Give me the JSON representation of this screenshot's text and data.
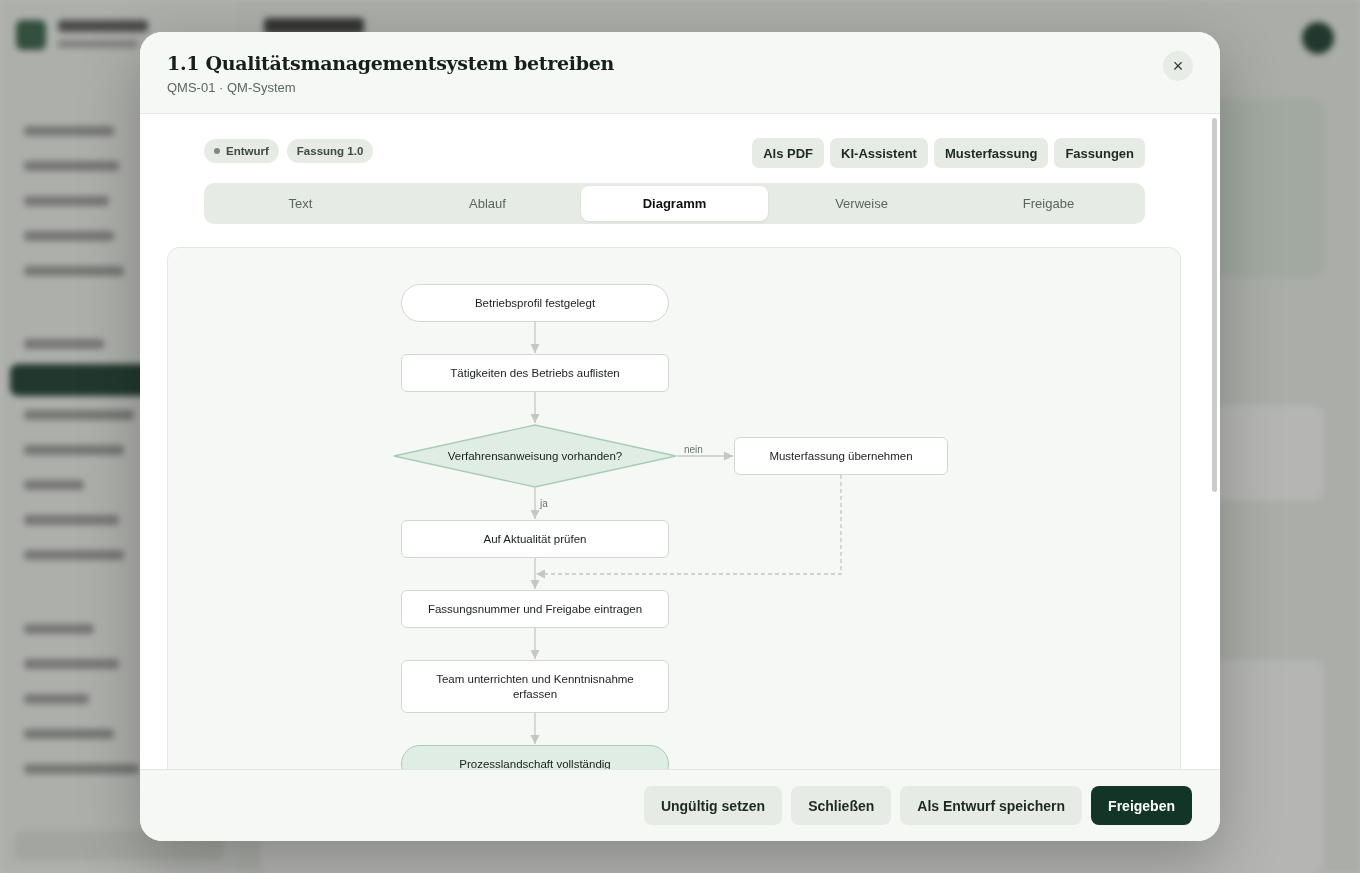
{
  "dialog": {
    "title": "1.1 Qualitätsmanagementsystem betreiben",
    "subtitle": "QMS-01 · QM-System",
    "close_label": "×"
  },
  "chips": [
    {
      "label": "Entwurf",
      "kind": "status"
    },
    {
      "label": "Fassung 1.0",
      "kind": "plain"
    }
  ],
  "actions": [
    "Als PDF",
    "KI-Assistent",
    "Musterfassung",
    "Fassungen"
  ],
  "tabs": [
    {
      "label": "Text",
      "selected": false
    },
    {
      "label": "Ablauf",
      "selected": false
    },
    {
      "label": "Diagramm",
      "selected": true
    },
    {
      "label": "Verweise",
      "selected": false
    },
    {
      "label": "Freigabe",
      "selected": false
    }
  ],
  "diagram": {
    "nodes": [
      {
        "kind": "terminal",
        "label": "Betriebsprofil festgelegt",
        "highlighted": false
      },
      {
        "kind": "process",
        "label": "Tätigkeiten des Betriebs auflisten"
      },
      {
        "kind": "decision",
        "label": "Verfahrensanweisung vorhanden?"
      },
      {
        "kind": "process",
        "label": "Musterfassung übernehmen"
      },
      {
        "kind": "process",
        "label": "Auf Aktualität prüfen"
      },
      {
        "kind": "process",
        "label": "Fassungsnummer und Freigabe eintragen"
      },
      {
        "kind": "process",
        "label": "Team unterrichten und Kenntnisnahme erfassen"
      },
      {
        "kind": "terminal",
        "label": "Prozesslandschaft vollständig",
        "highlighted": true
      }
    ],
    "edge_labels": [
      "nein",
      "ja"
    ]
  },
  "footer_buttons": [
    {
      "label": "Ungültig setzen",
      "kind": "secondary"
    },
    {
      "label": "Schließen",
      "kind": "secondary"
    },
    {
      "label": "Als Entwurf speichern",
      "kind": "secondary"
    },
    {
      "label": "Freigeben",
      "kind": "primary"
    }
  ]
}
